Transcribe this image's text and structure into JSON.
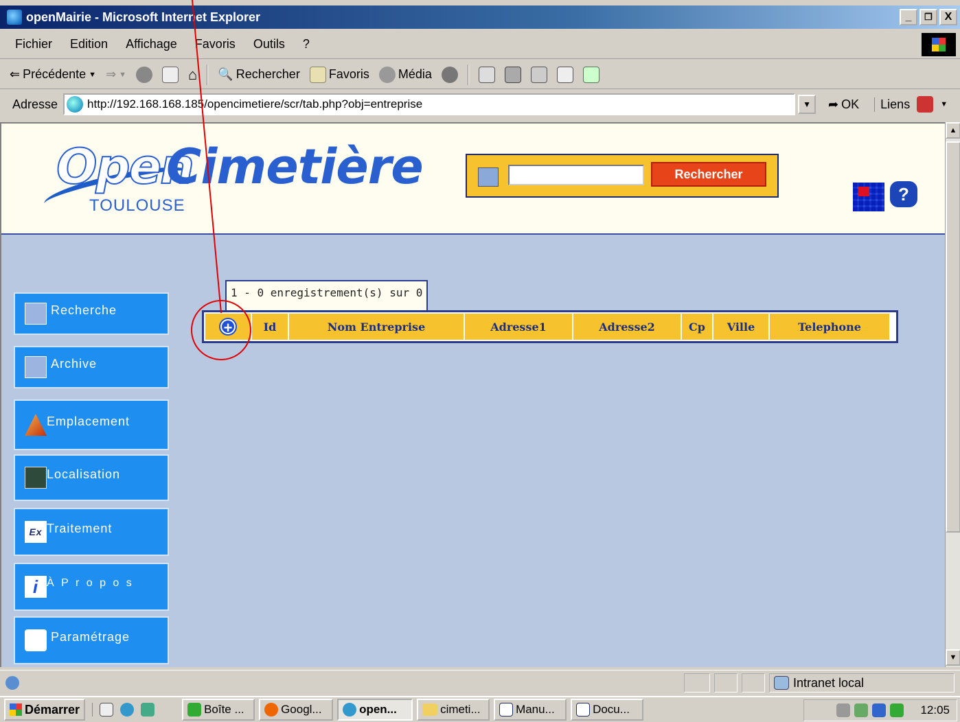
{
  "window": {
    "title": "openMairie - Microsoft Internet Explorer",
    "buttons": [
      "_",
      "Д",
      "X"
    ]
  },
  "menu": [
    "Fichier",
    "Edition",
    "Affichage",
    "Favoris",
    "Outils",
    "?"
  ],
  "toolbar": {
    "back": "Précédente",
    "search": "Rechercher",
    "favorites": "Favoris",
    "media": "Média"
  },
  "address": {
    "label": "Adresse",
    "url": "http://192.168.168.185/opencimetiere/scr/tab.php?obj=entreprise",
    "go": "OK",
    "links": "Liens"
  },
  "site": {
    "logo_open": "Open",
    "logo_cim": "Cimetière",
    "city": "TOULOUSE",
    "search_button": "Rechercher",
    "help": "?"
  },
  "nav": [
    {
      "label": "Recherche"
    },
    {
      "label": "Archive"
    },
    {
      "label": "Emplacement"
    },
    {
      "label": "Localisation"
    },
    {
      "label": "Traitement"
    },
    {
      "label": "À P r o p o s"
    },
    {
      "label": "Paramétrage"
    }
  ],
  "records_text": "1 - 0 enregistrement(s) sur 0",
  "table": {
    "add_icon": "plus-circle-icon",
    "columns": [
      "Id",
      "Nom Entreprise",
      "Adresse1",
      "Adresse2",
      "Cp",
      "Ville",
      "Telephone"
    ]
  },
  "status": {
    "zone": "Intranet local"
  },
  "taskbar": {
    "start": "Démarrer",
    "tasks": [
      "Boîte ...",
      "Googl...",
      "open...",
      "cimeti...",
      "Manu...",
      "Docu..."
    ],
    "clock": "12:05"
  },
  "colors": {
    "nav_bg": "#1e8ef0",
    "header_cell": "#f6c22d",
    "content_bg": "#b8c8e0",
    "annotation": "#e00000"
  }
}
